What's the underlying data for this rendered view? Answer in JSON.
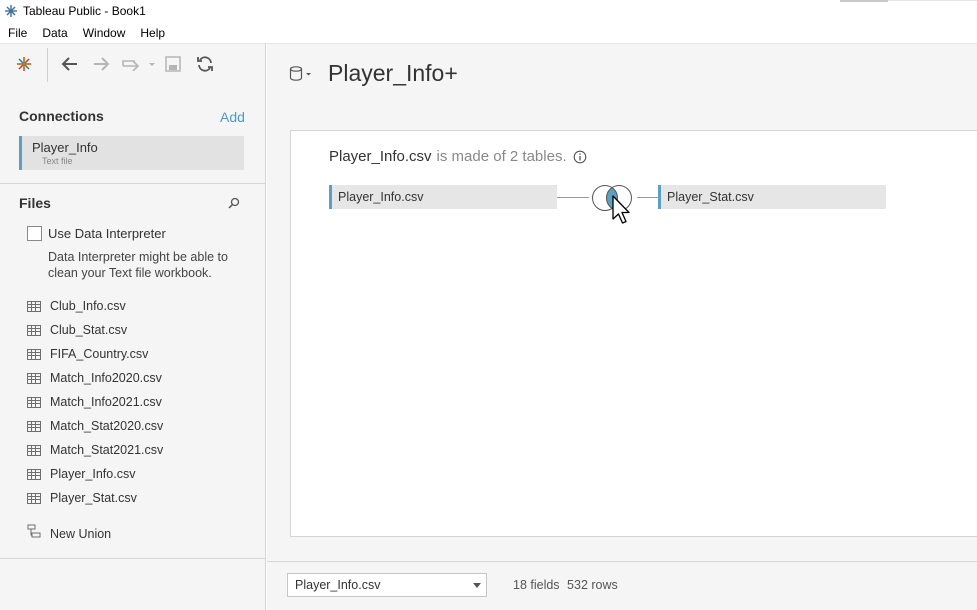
{
  "window": {
    "title": "Tableau Public - Book1"
  },
  "menubar": {
    "items": [
      "File",
      "Data",
      "Window",
      "Help"
    ]
  },
  "toolbar": {
    "icons": [
      "tableau-logo-icon",
      "back-icon",
      "forward-icon",
      "redo-icon",
      "save-icon",
      "refresh-icon"
    ]
  },
  "connections": {
    "header": "Connections",
    "add_label": "Add",
    "items": [
      {
        "name": "Player_Info",
        "type": "Text file"
      }
    ]
  },
  "files": {
    "header": "Files",
    "interpreter_label": "Use Data Interpreter",
    "interpreter_note": "Data Interpreter might be able to clean your Text file workbook.",
    "items": [
      "Club_Info.csv",
      "Club_Stat.csv",
      "FIFA_Country.csv",
      "Match_Info2020.csv",
      "Match_Info2021.csv",
      "Match_Stat2020.csv",
      "Match_Stat2021.csv",
      "Player_Info.csv",
      "Player_Stat.csv"
    ],
    "new_union_label": "New Union"
  },
  "datasource": {
    "title": "Player_Info+",
    "heading_main": "Player_Info.csv",
    "heading_sub": "is made of 2 tables.",
    "left_table": "Player_Info.csv",
    "right_table": "Player_Stat.csv",
    "join_type": "inner"
  },
  "footer": {
    "selected_table": "Player_Info.csv",
    "fields": "18 fields",
    "rows": "532 rows"
  },
  "colors": {
    "accent": "#5b9fc7",
    "link": "#4e9ac7",
    "panel_bg": "#f5f5f5"
  }
}
